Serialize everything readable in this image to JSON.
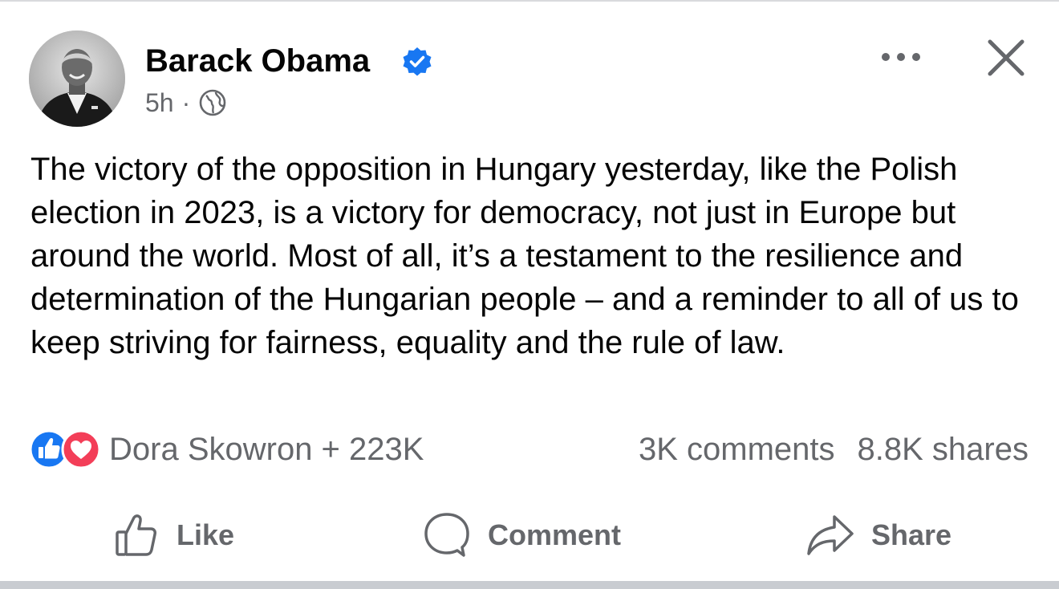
{
  "author": {
    "name": "Barack Obama",
    "verified": true,
    "timestamp": "5h",
    "separator": "·",
    "audience_icon": "globe-icon"
  },
  "post": {
    "text": "The victory of the opposition in Hungary yesterday, like the Polish election in 2023, is a victory for democracy, not just in Europe but around the world. Most of all, it’s a testament to the resilience and determination of the Hungarian people – and a reminder to all of us to keep striving for fairness, equality and the rule of law."
  },
  "reactions": {
    "icons": [
      "like-reaction-icon",
      "love-reaction-icon"
    ],
    "summary": "Dora Skowron + 223K",
    "comments": "3K comments",
    "shares": "8.8K shares"
  },
  "actions": {
    "like_label": "Like",
    "comment_label": "Comment",
    "share_label": "Share"
  },
  "header": {
    "more_icon": "more-options-icon",
    "close_icon": "close-icon"
  },
  "colors": {
    "text_primary": "#050505",
    "text_secondary": "#65676b",
    "verified_blue": "#1877f2",
    "like_blue": "#1877f2",
    "love_red": "#f33e58"
  }
}
